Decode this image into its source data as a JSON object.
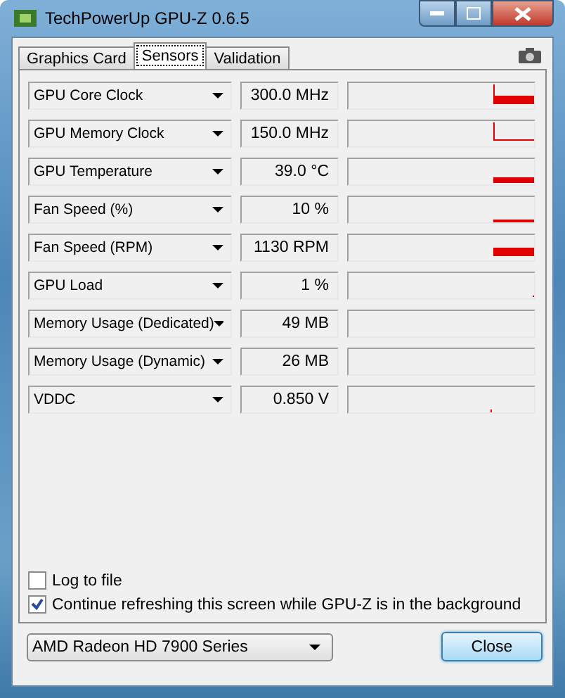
{
  "window": {
    "title": "TechPowerUp GPU-Z 0.6.5"
  },
  "tabs": [
    {
      "label": "Graphics Card",
      "selected": false
    },
    {
      "label": "Sensors",
      "selected": true
    },
    {
      "label": "Validation",
      "selected": false
    }
  ],
  "sensors": [
    {
      "name": "GPU Core Clock",
      "reading": "300.0 MHz",
      "kind": "step"
    },
    {
      "name": "GPU Memory Clock",
      "reading": "150.0 MHz",
      "kind": "stepline"
    },
    {
      "name": "GPU Temperature",
      "reading": "39.0 °C",
      "kind": "band"
    },
    {
      "name": "Fan Speed (%)",
      "reading": "10 %",
      "kind": "line"
    },
    {
      "name": "Fan Speed (RPM)",
      "reading": "1130 RPM",
      "kind": "bar"
    },
    {
      "name": "GPU Load",
      "reading": "1 %",
      "kind": "dot"
    },
    {
      "name": "Memory Usage (Dedicated)",
      "reading": "49 MB",
      "kind": "empty"
    },
    {
      "name": "Memory Usage (Dynamic)",
      "reading": "26 MB",
      "kind": "empty"
    },
    {
      "name": "VDDC",
      "reading": "0.850 V",
      "kind": "tick"
    }
  ],
  "options": [
    {
      "label": "Log to file",
      "checked": false
    },
    {
      "label": "Continue refreshing this screen while GPU-Z is in the background",
      "checked": true
    }
  ],
  "card_select": {
    "value": "AMD Radeon HD 7900 Series"
  },
  "close_button": "Close"
}
